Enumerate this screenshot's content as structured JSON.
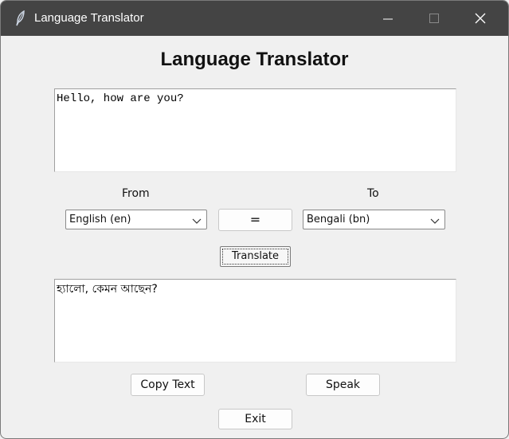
{
  "window": {
    "title": "Language Translator",
    "icon": "feather-icon"
  },
  "header": {
    "title": "Language Translator"
  },
  "source": {
    "text": "Hello, how are you?"
  },
  "from": {
    "label": "From",
    "selected": "English (en)"
  },
  "to": {
    "label": "To",
    "selected": "Bengali (bn)"
  },
  "buttons": {
    "swap": "=",
    "translate": "Translate",
    "copy": "Copy Text",
    "speak": "Speak",
    "exit": "Exit"
  },
  "output": {
    "text": "হ্যালো, কেমন আছেন?"
  },
  "colors": {
    "titlebar": "#444444",
    "background": "#f0f0f0"
  }
}
